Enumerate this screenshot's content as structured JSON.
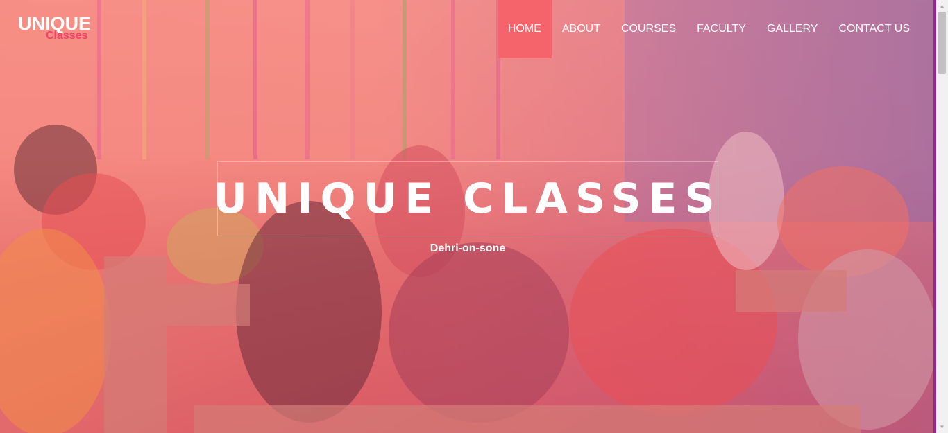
{
  "logo": {
    "main": "UNIQUE",
    "sub": "Classes"
  },
  "nav": [
    {
      "label": "HOME",
      "active": true
    },
    {
      "label": "ABOUT",
      "active": false
    },
    {
      "label": "COURSES",
      "active": false
    },
    {
      "label": "FACULTY",
      "active": false
    },
    {
      "label": "GALLERY",
      "active": false
    },
    {
      "label": "CONTACT US",
      "active": false
    }
  ],
  "hero": {
    "title": "UNIQUE CLASSES",
    "subtitle": "Dehri-on-sone"
  },
  "colors": {
    "accent": "#f4646a",
    "logo_sub": "#f2416a",
    "edge": "#8e2c8e"
  },
  "scrollbar": {
    "up_icon": "triangle-up",
    "down_icon": "triangle-down"
  }
}
